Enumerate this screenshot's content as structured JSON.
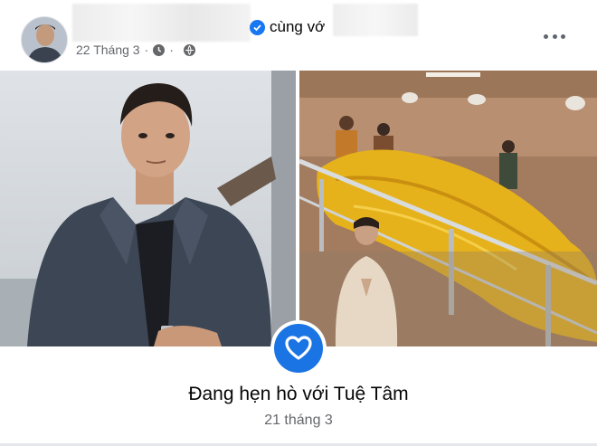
{
  "post": {
    "with_label": "cùng vớ",
    "date": "22 Tháng 3",
    "dot": "·",
    "verified_icon": "verified-badge-icon",
    "privacy_icon": "globe-icon",
    "more_icon": "more-options-icon"
  },
  "life_event": {
    "title": "Đang hẹn hò với Tuệ Tâm",
    "date": "21 tháng 3",
    "icon": "heart-icon",
    "accent": "#1b74e4"
  }
}
